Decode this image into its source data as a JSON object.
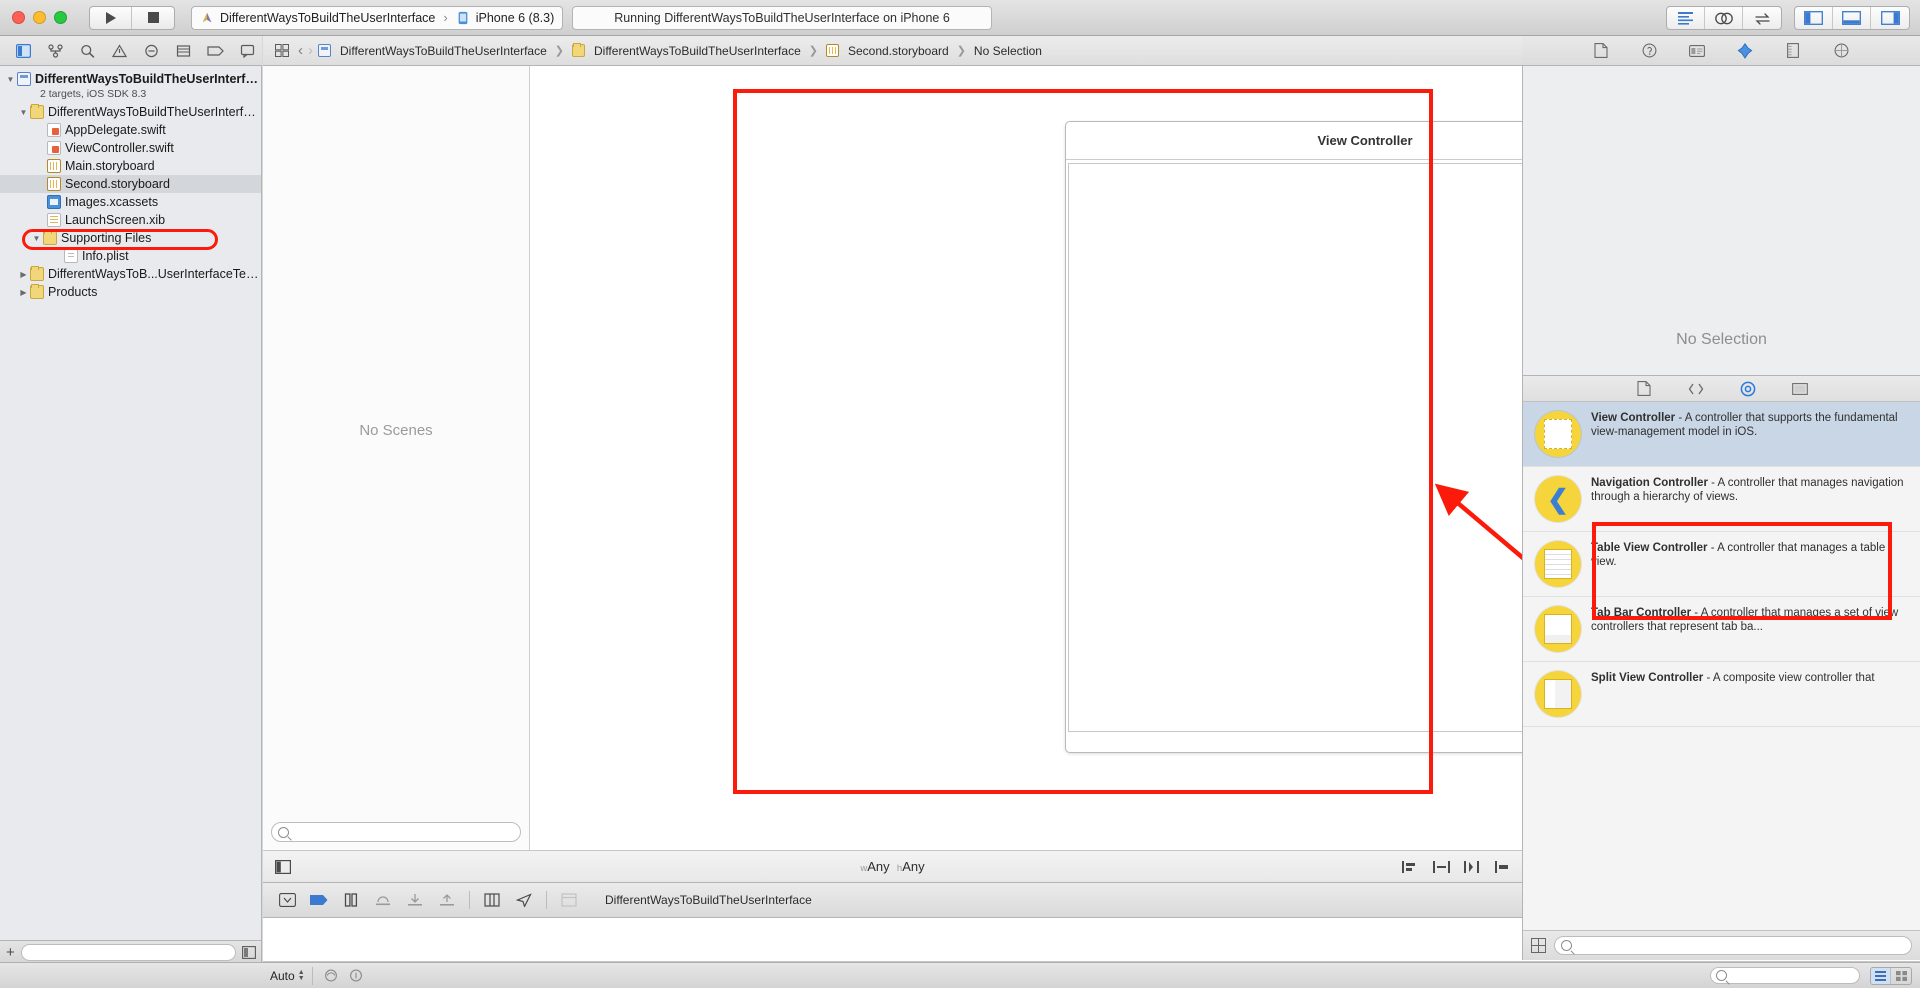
{
  "titlebar": {
    "run_label": "run-button",
    "stop_label": "stop-button",
    "scheme_name": "DifferentWaysToBuildTheUserInterface",
    "scheme_separator": "›",
    "destination": "iPhone 6 (8.3)",
    "status": "Running DifferentWaysToBuildTheUserInterface on iPhone 6"
  },
  "navigator": {
    "toolbar_icons": [
      "folder-icon",
      "source-control-icon",
      "search-icon",
      "warning-icon",
      "breakpoint-icon",
      "report-icon",
      "tag-icon",
      "comment-icon"
    ],
    "tree": [
      {
        "label": "DifferentWaysToBuildTheUserInterface",
        "subtitle": "2 targets, iOS SDK 8.3",
        "icon": "project-icon",
        "indent": 0,
        "twisty": "▼",
        "bold": true
      },
      {
        "label": "DifferentWaysToBuildTheUserInterface",
        "icon": "folder-icon",
        "indent": 1,
        "twisty": "▼",
        "bold": false
      },
      {
        "label": "AppDelegate.swift",
        "icon": "swift-icon",
        "indent": 2,
        "twisty": "",
        "bold": false
      },
      {
        "label": "ViewController.swift",
        "icon": "swift-icon",
        "indent": 2,
        "twisty": "",
        "bold": false
      },
      {
        "label": "Main.storyboard",
        "icon": "storyboard-icon",
        "indent": 2,
        "twisty": "",
        "bold": false
      },
      {
        "label": "Second.storyboard",
        "icon": "storyboard-icon",
        "indent": 2,
        "twisty": "",
        "bold": false,
        "selected": true
      },
      {
        "label": "Images.xcassets",
        "icon": "xcassets-icon",
        "indent": 2,
        "twisty": "",
        "bold": false
      },
      {
        "label": "LaunchScreen.xib",
        "icon": "xib-icon",
        "indent": 2,
        "twisty": "",
        "bold": false
      },
      {
        "label": "Supporting Files",
        "icon": "folder-icon",
        "indent": 2,
        "twisty": "▼",
        "bold": false
      },
      {
        "label": "Info.plist",
        "icon": "plist-icon",
        "indent": 3,
        "twisty": "",
        "bold": false
      },
      {
        "label": "DifferentWaysToB...UserInterfaceTests",
        "icon": "folder-icon",
        "indent": 1,
        "twisty": "▶",
        "bold": false
      },
      {
        "label": "Products",
        "icon": "folder-icon",
        "indent": 1,
        "twisty": "▶",
        "bold": false
      }
    ],
    "filter_placeholder": ""
  },
  "jumpbar": {
    "back": "‹",
    "forward": "›",
    "crumbs": [
      {
        "label": "DifferentWaysToBuildTheUserInterface",
        "icon": "project-icon"
      },
      {
        "label": "DifferentWaysToBuildTheUserInterface",
        "icon": "folder-icon"
      },
      {
        "label": "Second.storyboard",
        "icon": "storyboard-icon"
      },
      {
        "label": "No Selection",
        "icon": ""
      }
    ]
  },
  "canvas": {
    "outline_empty_text": "No Scenes",
    "outline_filter_placeholder": "",
    "scene_title": "View Controller",
    "size_class_w_prefix": "w",
    "size_class_w": "Any",
    "size_class_h_prefix": "h",
    "size_class_h": "Any"
  },
  "debugbar": {
    "breadcrumb": "DifferentWaysToBuildTheUserInterface"
  },
  "statusbar": {
    "auto_label": "Auto",
    "search_placeholder": ""
  },
  "inspector": {
    "no_selection": "No Selection",
    "toolbar_icons": [
      "file-inspector-icon",
      "quick-help-icon",
      "identity-inspector-icon",
      "attributes-inspector-icon",
      "size-inspector-icon",
      "connections-inspector-icon"
    ]
  },
  "library": {
    "tabs": [
      "file-template-library-icon",
      "code-snippet-library-icon",
      "object-library-icon",
      "media-library-icon"
    ],
    "active_tab_index": 2,
    "items": [
      {
        "title": "View Controller",
        "description": " - A controller that supports the fundamental view-management model in iOS.",
        "icon": "view-controller-icon",
        "selected": true
      },
      {
        "title": "Navigation Controller",
        "description": " - A controller that manages navigation through a hierarchy of views.",
        "icon": "navigation-controller-icon",
        "selected": false
      },
      {
        "title": "Table View Controller",
        "description": " - A controller that manages a table view.",
        "icon": "table-view-controller-icon",
        "selected": false
      },
      {
        "title": "Tab Bar Controller",
        "description": " - A controller that manages a set of view controllers that represent tab ba...",
        "icon": "tab-bar-controller-icon",
        "selected": false
      },
      {
        "title": "Split View Controller",
        "description": " - A composite view controller that",
        "icon": "split-view-controller-icon",
        "selected": false
      }
    ],
    "filter_placeholder": ""
  },
  "annotations": {
    "highlight_color": "#fc1b0a"
  }
}
